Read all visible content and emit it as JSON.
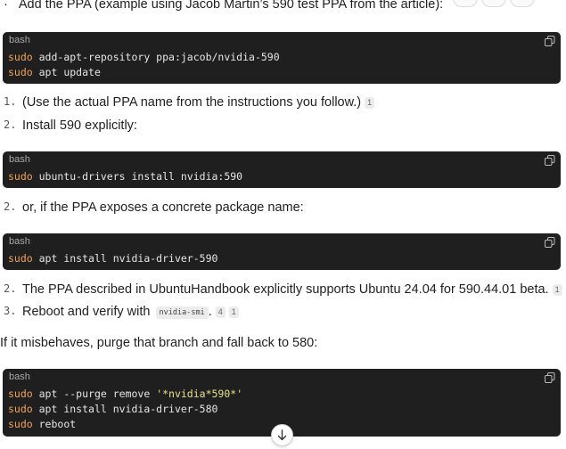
{
  "intro": {
    "marker": "·",
    "text": "Add the PPA (example using Jacob Martin’s 590 test PPA from the article):"
  },
  "blocks": [
    {
      "lang": "bash",
      "lines": [
        {
          "cmd": "sudo",
          "rest": " add-apt-repository ppa:jacob/nvidia-590"
        },
        {
          "cmd": "sudo",
          "rest": " apt update"
        }
      ]
    },
    {
      "lang": "bash",
      "lines": [
        {
          "cmd": "sudo",
          "rest": " ubuntu-drivers install nvidia:590"
        }
      ]
    },
    {
      "lang": "bash",
      "lines": [
        {
          "cmd": "sudo",
          "rest": " apt install nvidia-driver-590"
        }
      ]
    },
    {
      "lang": "bash",
      "lines": [
        {
          "cmd": "sudo",
          "rest": " apt --purge remove ",
          "str": "'*nvidia*590*'"
        },
        {
          "cmd": "sudo",
          "rest": " apt install nvidia-driver-580"
        },
        {
          "cmd": "sudo",
          "rest": " reboot"
        }
      ]
    }
  ],
  "items": {
    "i1": {
      "num": "1.",
      "text": "(Use the actual PPA name from the instructions you follow.)",
      "cite": "1"
    },
    "i2": {
      "num": "2.",
      "text": "Install 590 explicitly:"
    },
    "i3": {
      "num": "2.",
      "text": "or, if the PPA exposes a concrete package name:"
    },
    "i4": {
      "num": "2.",
      "text": "The PPA described in UbuntuHandbook explicitly supports Ubuntu 24.04 for 590.44.01 beta.",
      "cite": "1"
    },
    "i5": {
      "num": "3.",
      "text": "Reboot and verify with",
      "code": "nvidia-smi",
      "after": ".",
      "cite_a": "4",
      "cite_b": "1"
    }
  },
  "fallback_text": "If it misbehaves, purge that branch and fall back to 580:",
  "icons": {
    "copy": "copy-icon",
    "scroll": "arrow-down-icon"
  }
}
